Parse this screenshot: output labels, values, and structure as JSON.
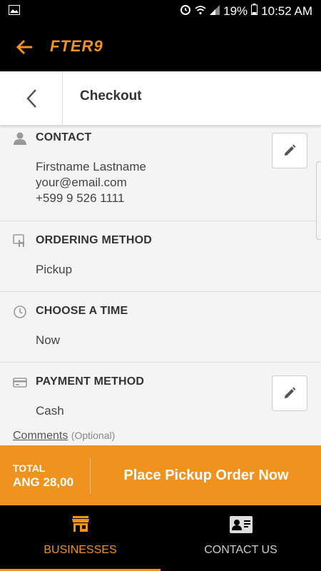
{
  "status_bar": {
    "battery": "19%",
    "time": "10:52 AM"
  },
  "app": {
    "logo": "FTER9"
  },
  "header": {
    "title": "Checkout"
  },
  "sections": {
    "contact": {
      "title": "CONTACT",
      "name": "Firstname Lastname",
      "email": "your@email.com",
      "phone": "+599 9 526 1111"
    },
    "ordering": {
      "title": "ORDERING METHOD",
      "value": "Pickup"
    },
    "time": {
      "title": "CHOOSE A TIME",
      "value": "Now"
    },
    "payment": {
      "title": "PAYMENT METHOD",
      "value": "Cash"
    }
  },
  "comments": {
    "label": "Comments",
    "optional": "(Optional)"
  },
  "order_bar": {
    "total_label": "TOTAL",
    "total_amount": "ANG 28,00",
    "button": "Place Pickup Order Now"
  },
  "bottom_nav": [
    {
      "label": "BUSINESSES",
      "icon": "store-icon",
      "active": true
    },
    {
      "label": "CONTACT US",
      "icon": "contact-card-icon",
      "active": false
    }
  ],
  "colors": {
    "accent": "#f0921e",
    "bar": "#000000",
    "background": "#f4f4f4"
  }
}
